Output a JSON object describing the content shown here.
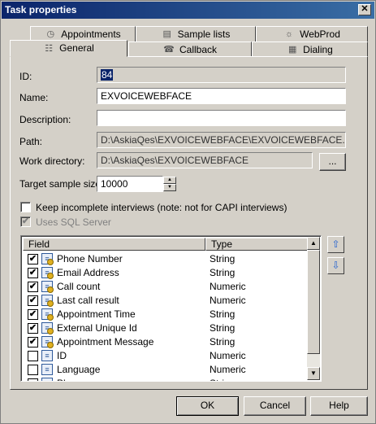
{
  "window": {
    "title": "Task properties",
    "close_glyph": "✕"
  },
  "tabs_back": [
    {
      "label": "Appointments",
      "icon": "appointments-icon",
      "glyph": "◷"
    },
    {
      "label": "Sample lists",
      "icon": "sample-lists-icon",
      "glyph": "▤"
    },
    {
      "label": "WebProd",
      "icon": "webprod-icon",
      "glyph": "☼"
    }
  ],
  "tabs_front": [
    {
      "label": "General",
      "icon": "general-icon",
      "glyph": "☷",
      "active": true
    },
    {
      "label": "Callback",
      "icon": "callback-icon",
      "glyph": "☎"
    },
    {
      "label": "Dialing",
      "icon": "dialing-icon",
      "glyph": "▦"
    }
  ],
  "general": {
    "id_label": "ID:",
    "id_value": "84",
    "name_label": "Name:",
    "name_value": "EXVOICEWEBFACE",
    "description_label": "Description:",
    "description_value": "",
    "path_label": "Path:",
    "path_value": "D:\\AskiaQes\\EXVOICEWEBFACE\\EXVOICEWEBFACE.qes",
    "workdir_label": "Work directory:",
    "workdir_value": "D:\\AskiaQes\\EXVOICEWEBFACE",
    "browse_label": "...",
    "target_label": "Target sample size:",
    "target_value": "10000",
    "keep_incomplete_label": "Keep incomplete interviews (note: not for CAPI interviews)",
    "keep_incomplete_checked": false,
    "uses_sql_label": "Uses SQL Server",
    "uses_sql_checked": true
  },
  "fields_table": {
    "columns": [
      "Field",
      "Type"
    ],
    "rows": [
      {
        "checked": true,
        "key": true,
        "field": "Phone Number",
        "type": "String"
      },
      {
        "checked": true,
        "key": true,
        "field": "Email Address",
        "type": "String"
      },
      {
        "checked": true,
        "key": true,
        "field": "Call count",
        "type": "Numeric"
      },
      {
        "checked": true,
        "key": true,
        "field": "Last call result",
        "type": "Numeric"
      },
      {
        "checked": true,
        "key": true,
        "field": "Appointment Time",
        "type": "String"
      },
      {
        "checked": true,
        "key": true,
        "field": "External Unique Id",
        "type": "String"
      },
      {
        "checked": true,
        "key": true,
        "field": "Appointment Message",
        "type": "String"
      },
      {
        "checked": false,
        "key": false,
        "field": "ID",
        "type": "Numeric"
      },
      {
        "checked": false,
        "key": false,
        "field": "Language",
        "type": "Numeric"
      },
      {
        "checked": false,
        "key": false,
        "field": "Phone",
        "type": "String"
      }
    ]
  },
  "move_up_glyph": "⇧",
  "move_down_glyph": "⇩",
  "scroll_up_glyph": "▲",
  "scroll_down_glyph": "▼",
  "buttons": {
    "ok": "OK",
    "cancel": "Cancel",
    "help": "Help"
  }
}
